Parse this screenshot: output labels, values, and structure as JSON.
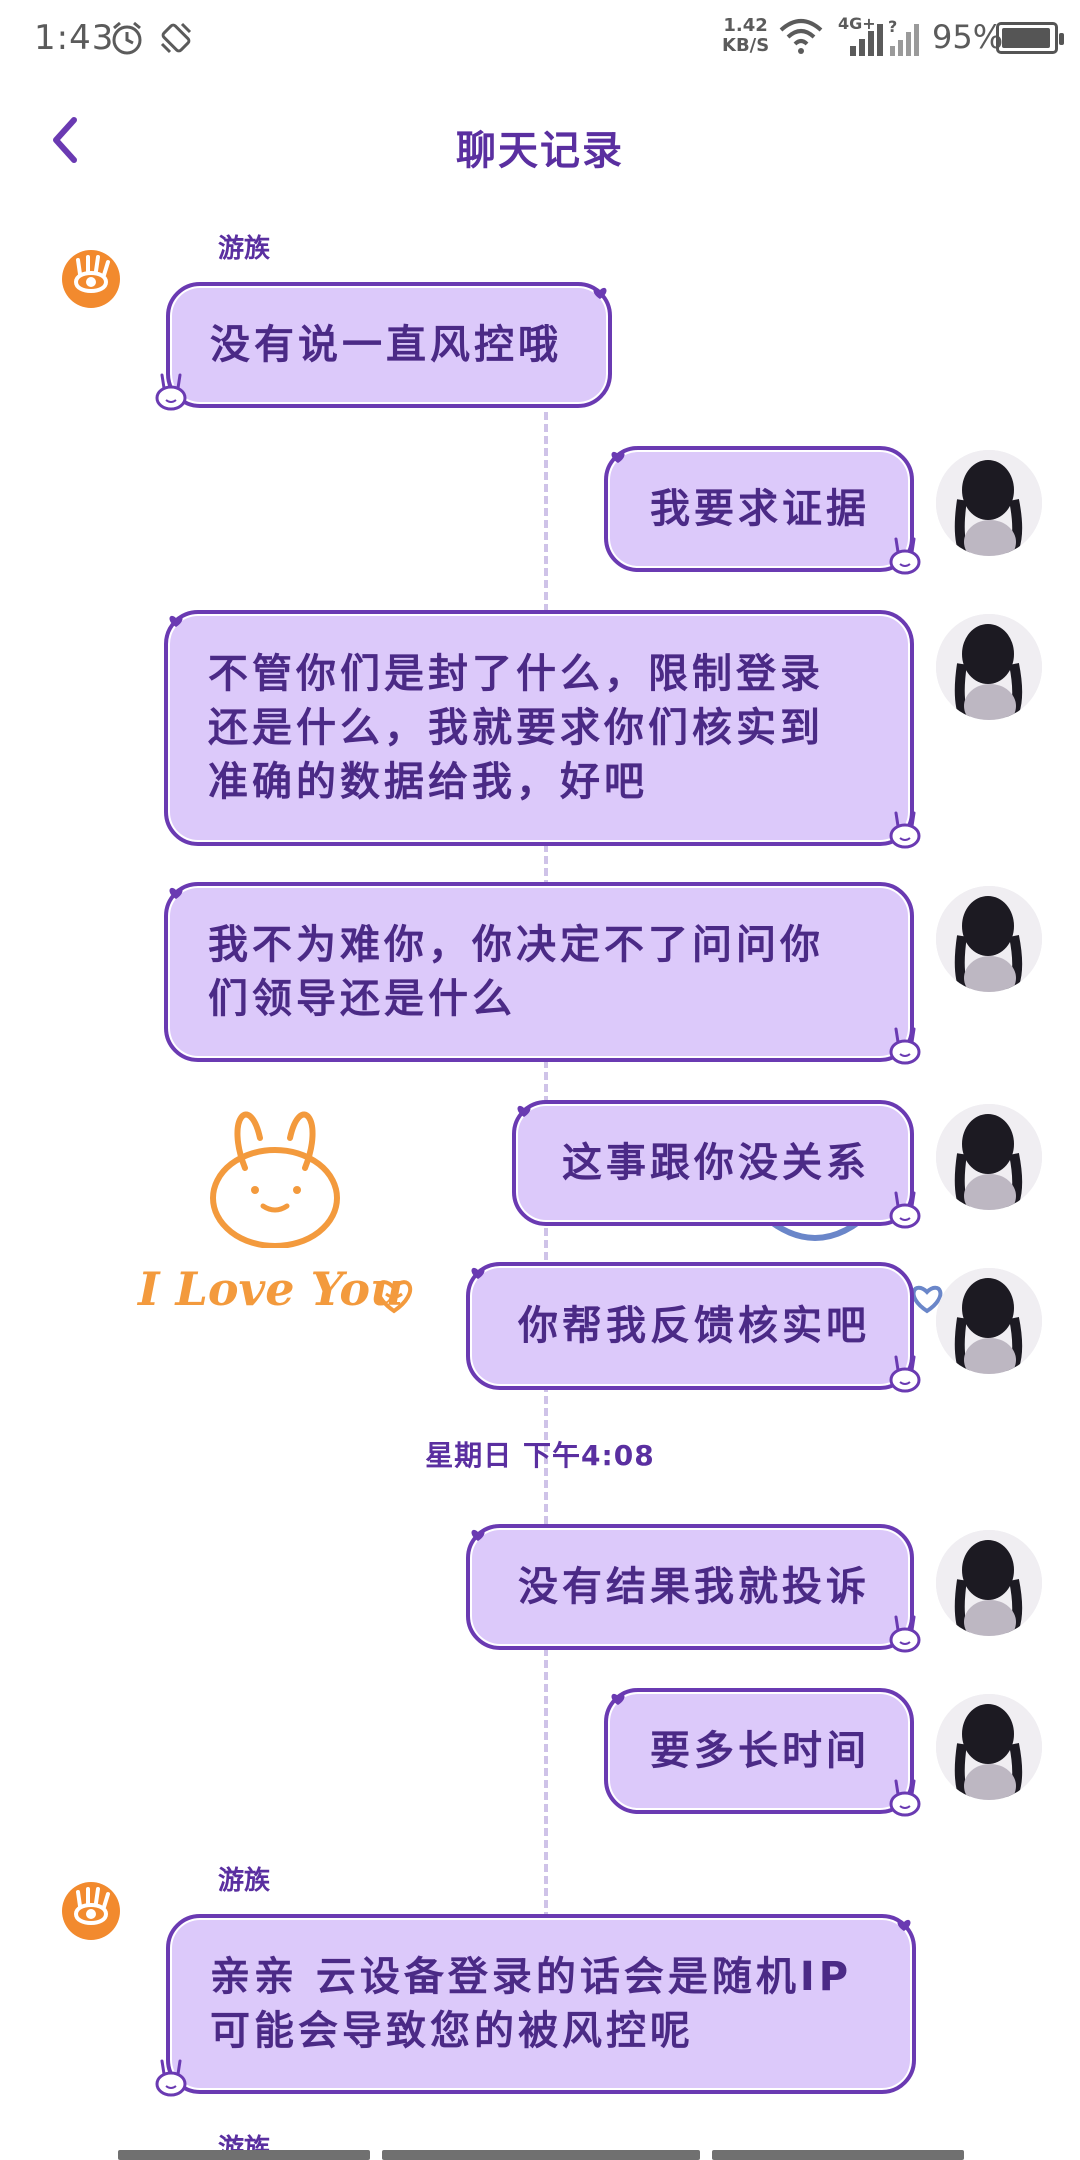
{
  "status_bar": {
    "time": "1:43",
    "speed_value": "1.42",
    "speed_unit": "KB/S",
    "network": "4G+",
    "battery_percent": "95%",
    "battery_level": 0.95
  },
  "header": {
    "title": "聊天记录",
    "back_icon": "chevron-left-icon"
  },
  "messages": [
    {
      "side": "left",
      "sender": "游族",
      "text": "没有说一直风控哦"
    },
    {
      "side": "right",
      "text": "我要求证据"
    },
    {
      "side": "right",
      "lines": [
        "不管你们是封了什么，限制登录",
        "还是什么，我就要求你们核实到",
        "准确的数据给我，好吧"
      ]
    },
    {
      "side": "right",
      "lines": [
        "我不为难你，你决定不了问问你",
        "们领导还是什么"
      ]
    },
    {
      "side": "right",
      "text": "这事跟你没关系"
    },
    {
      "side": "right",
      "text": "你帮我反馈核实吧"
    },
    {
      "side": "right",
      "text": "没有结果我就投诉"
    },
    {
      "side": "right",
      "text": "要多长时间"
    },
    {
      "side": "left",
      "sender": "游族",
      "lines": [
        "亲亲 云设备登录的话会是随机IP",
        "可能会导致您的被风控呢"
      ]
    }
  ],
  "timestamp": "星期日 下午4:08",
  "sticker": {
    "text": "I Love You",
    "color": "#f39a3d"
  },
  "peek_sender": "游族",
  "colors": {
    "bubble_fill": "#dcc9fa",
    "bubble_border": "#6a3ab2",
    "accent": "#5a2fa0",
    "agent_avatar": "#f28a2e"
  }
}
